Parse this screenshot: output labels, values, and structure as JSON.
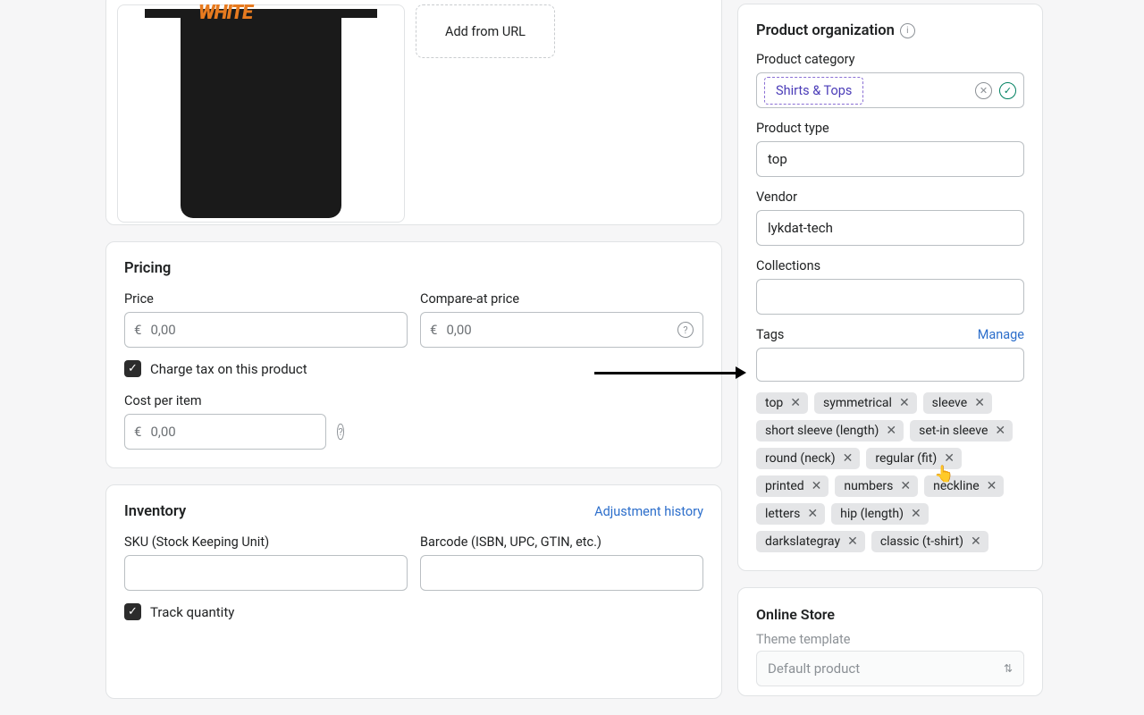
{
  "media": {
    "add_url": "Add from URL"
  },
  "pricing": {
    "title": "Pricing",
    "price_label": "Price",
    "compare_label": "Compare-at price",
    "currency": "€",
    "price_value": "0,00",
    "compare_value": "0,00",
    "tax_label": "Charge tax on this product",
    "cost_label": "Cost per item",
    "cost_value": "0,00"
  },
  "inventory": {
    "title": "Inventory",
    "history_link": "Adjustment history",
    "sku_label": "SKU (Stock Keeping Unit)",
    "barcode_label": "Barcode (ISBN, UPC, GTIN, etc.)",
    "track_label": "Track quantity"
  },
  "org": {
    "title": "Product organization",
    "category_label": "Product category",
    "category_value": "Shirts & Tops",
    "type_label": "Product type",
    "type_value": "top",
    "vendor_label": "Vendor",
    "vendor_value": "lykdat-tech",
    "collections_label": "Collections",
    "tags_label": "Tags",
    "manage": "Manage",
    "tags": [
      "top",
      "symmetrical",
      "sleeve",
      "short sleeve (length)",
      "set-in sleeve",
      "round (neck)",
      "regular (fit)",
      "printed",
      "numbers",
      "neckline",
      "letters",
      "hip (length)",
      "darkslategray",
      "classic (t-shirt)"
    ]
  },
  "store": {
    "title": "Online Store",
    "theme_label": "Theme template",
    "theme_value": "Default product"
  }
}
